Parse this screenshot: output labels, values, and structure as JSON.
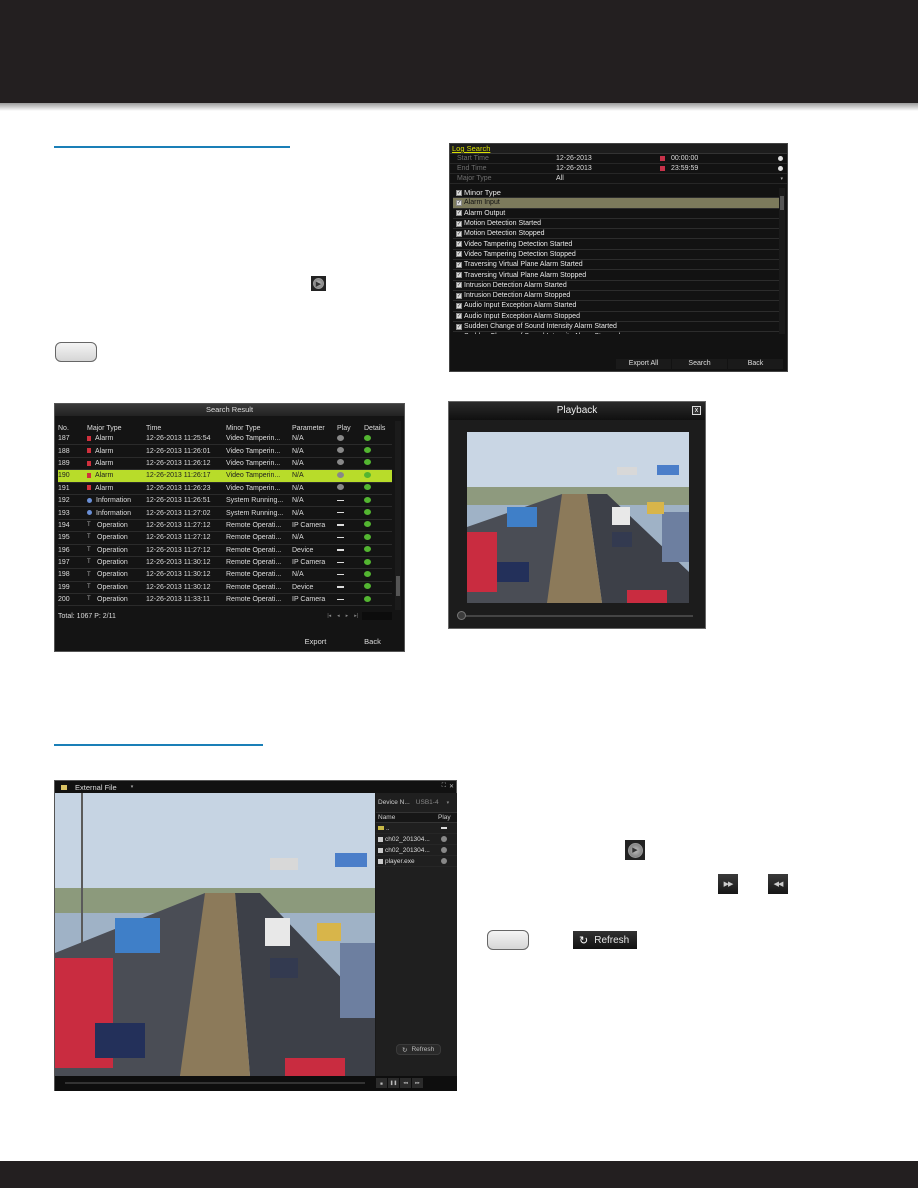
{
  "log_search": {
    "title": "Log Search",
    "fields": [
      {
        "label": "Start Time",
        "date": "12-26-2013",
        "time": "00:00:00"
      },
      {
        "label": "End Time",
        "date": "12-26-2013",
        "time": "23:59:59"
      }
    ],
    "major_type": {
      "label": "Major Type",
      "value": "All"
    },
    "minor_type_header": "Minor Type",
    "minor_types": [
      "Alarm Input",
      "Alarm Output",
      "Motion Detection Started",
      "Motion Detection Stopped",
      "Video Tampering Detection Started",
      "Video Tampering Detection Stopped",
      "Traversing Virtual Plane Alarm Started",
      "Traversing Virtual Plane Alarm Stopped",
      "Intrusion Detection Alarm Started",
      "Intrusion Detection Alarm Stopped",
      "Audio Input Exception Alarm Started",
      "Audio Input Exception Alarm Stopped",
      "Sudden Change of Sound Intensity Alarm Started",
      "Sudden Change of Sound Intensity Alarm Stopped"
    ],
    "selected_index": 0,
    "buttons": {
      "export_all": "Export All",
      "search": "Search",
      "back": "Back"
    }
  },
  "search_result": {
    "title": "Search Result",
    "columns": [
      "No.",
      "Major Type",
      "Time",
      "Minor Type",
      "Parameter",
      "Play",
      "Details"
    ],
    "rows": [
      {
        "no": "187",
        "major": "Alarm",
        "kind": "alarm",
        "time": "12-26-2013 11:25:54",
        "minor": "Video Tamperin...",
        "param": "N/A",
        "play": "play"
      },
      {
        "no": "188",
        "major": "Alarm",
        "kind": "alarm",
        "time": "12-26-2013 11:26:01",
        "minor": "Video Tamperin...",
        "param": "N/A",
        "play": "play"
      },
      {
        "no": "189",
        "major": "Alarm",
        "kind": "alarm",
        "time": "12-26-2013 11:26:12",
        "minor": "Video Tamperin...",
        "param": "N/A",
        "play": "play"
      },
      {
        "no": "190",
        "major": "Alarm",
        "kind": "alarm",
        "time": "12-26-2013 11:26:17",
        "minor": "Video Tamperin...",
        "param": "N/A",
        "play": "play",
        "selected": true
      },
      {
        "no": "191",
        "major": "Alarm",
        "kind": "alarm",
        "time": "12-26-2013 11:26:23",
        "minor": "Video Tamperin...",
        "param": "N/A",
        "play": "play"
      },
      {
        "no": "192",
        "major": "Information",
        "kind": "info",
        "time": "12-26-2013 11:26:51",
        "minor": "System Running...",
        "param": "N/A",
        "play": "none"
      },
      {
        "no": "193",
        "major": "Information",
        "kind": "info",
        "time": "12-26-2013 11:27:02",
        "minor": "System Running...",
        "param": "N/A",
        "play": "none"
      },
      {
        "no": "194",
        "major": "Operation",
        "kind": "op",
        "time": "12-26-2013 11:27:12",
        "minor": "Remote Operati...",
        "param": "IP Camera",
        "play": "none"
      },
      {
        "no": "195",
        "major": "Operation",
        "kind": "op",
        "time": "12-26-2013 11:27:12",
        "minor": "Remote Operati...",
        "param": "N/A",
        "play": "none"
      },
      {
        "no": "196",
        "major": "Operation",
        "kind": "op",
        "time": "12-26-2013 11:27:12",
        "minor": "Remote Operati...",
        "param": "Device",
        "play": "none"
      },
      {
        "no": "197",
        "major": "Operation",
        "kind": "op",
        "time": "12-26-2013 11:30:12",
        "minor": "Remote Operati...",
        "param": "IP Camera",
        "play": "none"
      },
      {
        "no": "198",
        "major": "Operation",
        "kind": "op",
        "time": "12-26-2013 11:30:12",
        "minor": "Remote Operati...",
        "param": "N/A",
        "play": "none"
      },
      {
        "no": "199",
        "major": "Operation",
        "kind": "op",
        "time": "12-26-2013 11:30:12",
        "minor": "Remote Operati...",
        "param": "Device",
        "play": "none"
      },
      {
        "no": "200",
        "major": "Operation",
        "kind": "op",
        "time": "12-26-2013 11:33:11",
        "minor": "Remote Operati...",
        "param": "IP Camera",
        "play": "none"
      }
    ],
    "footer": "Total: 1067  P: 2/11",
    "pager": [
      "|◂",
      "◂",
      "▸",
      "▸|"
    ],
    "buttons": {
      "export": "Export",
      "back": "Back"
    }
  },
  "playback": {
    "title": "Playback",
    "close": "x",
    "progress": 0
  },
  "external_file": {
    "title": "External File",
    "device_label": "Device N...",
    "device_value": "USB1-4",
    "columns": [
      "Name",
      "Play"
    ],
    "files": [
      {
        "name": "..",
        "type": "folder"
      },
      {
        "name": "ch02_201304...",
        "type": "file"
      },
      {
        "name": "ch02_201304...",
        "type": "file"
      },
      {
        "name": "player.exe",
        "type": "file"
      }
    ],
    "refresh": "Refresh",
    "controls": [
      "■",
      "❚❚",
      "◂◂",
      "▸▸"
    ],
    "progress": 0
  },
  "doc": {
    "refresh_button": "Refresh",
    "icons": [
      "play-icon",
      "fast-forward-icon",
      "rewind-icon"
    ]
  },
  "colors": {
    "band": "#231f20",
    "rule": "#1a7fb7",
    "selected_row": "#b8dc2a",
    "title_accent": "#d8e000"
  }
}
